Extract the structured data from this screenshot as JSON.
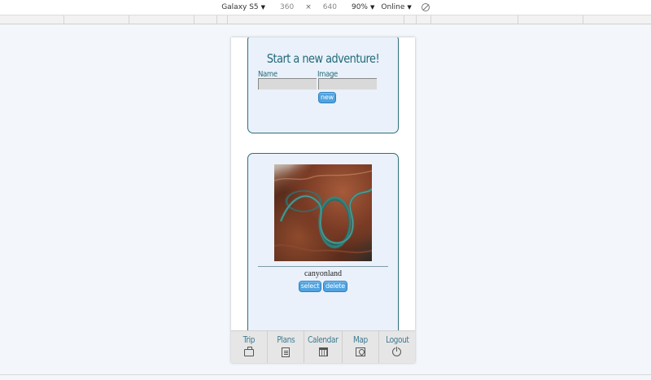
{
  "devtools": {
    "device": "Galaxy S5",
    "width": "360",
    "times": "×",
    "height": "640",
    "zoom": "90%",
    "network": "Online"
  },
  "new_trip": {
    "title": "Start a new adventure!",
    "name_label": "Name",
    "image_label": "Image",
    "name_value": "",
    "image_value": "",
    "new_button": "new"
  },
  "trip_card": {
    "name": "canyonland",
    "select_button": "select",
    "delete_button": "delete"
  },
  "nav": {
    "items": [
      {
        "label": "Trip",
        "icon": "briefcase-icon"
      },
      {
        "label": "Plans",
        "icon": "document-edit-icon"
      },
      {
        "label": "Calendar",
        "icon": "calendar-icon"
      },
      {
        "label": "Map",
        "icon": "map-icon"
      },
      {
        "label": "Logout",
        "icon": "power-icon"
      }
    ]
  },
  "colors": {
    "accent": "#246a7a",
    "button": "#4fa3e0",
    "card_bg": "#eaf1fa",
    "card_border": "#2d6f78"
  }
}
